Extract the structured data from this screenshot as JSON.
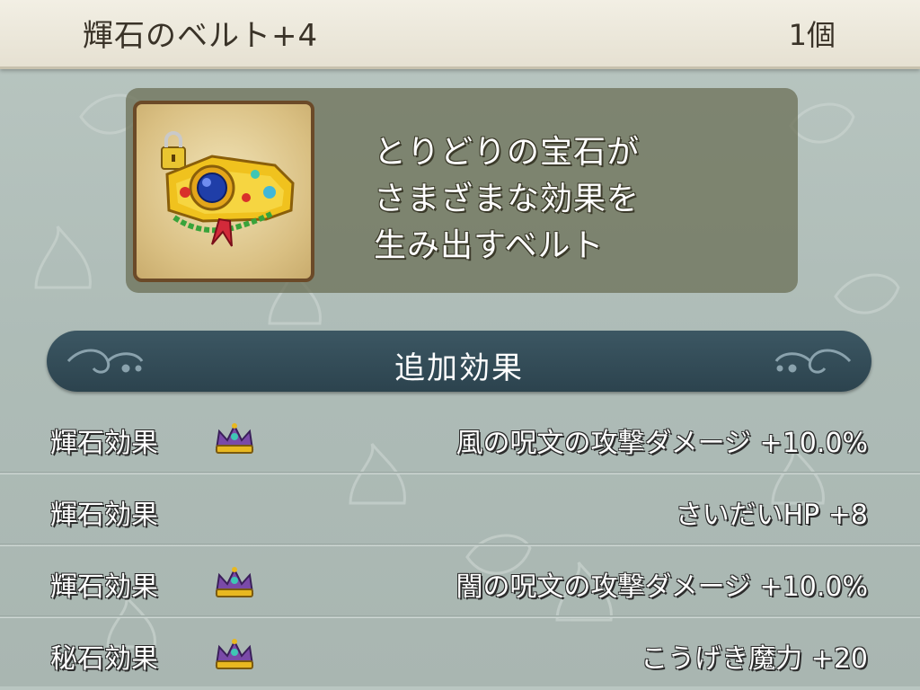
{
  "item": {
    "name": "輝石のベルト+4",
    "count": "1個",
    "icon": "gem-belt-icon",
    "description": [
      "とりどりの宝石が",
      "さまざまな効果を",
      "生み出すベルト"
    ]
  },
  "section": {
    "title": "追加効果"
  },
  "effects": [
    {
      "label": "輝石効果",
      "icon": "crown-icon",
      "value": "風の呪文の攻撃ダメージ +10.0%"
    },
    {
      "label": "輝石効果",
      "icon": "",
      "value": "さいだいHP +8"
    },
    {
      "label": "輝石効果",
      "icon": "crown-icon",
      "value": "闇の呪文の攻撃ダメージ +10.0%"
    },
    {
      "label": "秘石効果",
      "icon": "crown-icon",
      "value": "こうげき魔力 +20"
    }
  ],
  "colors": {
    "title_bar": "#ece8db",
    "panel": "#686c52",
    "section_header": "#34505c",
    "text": "#ffffff"
  }
}
